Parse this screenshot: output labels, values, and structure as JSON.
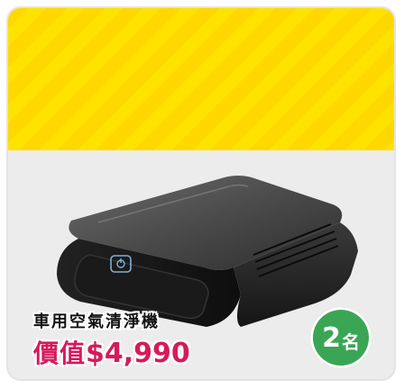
{
  "prize": {
    "product_name": "車用空氣清淨機",
    "price_label": "價值",
    "price_value": "$4,990",
    "quantity_number": "2",
    "quantity_unit": "名"
  },
  "colors": {
    "banner_yellow": "#ffd800",
    "price_pink": "#d61a5c",
    "badge_green": "#3aa655"
  },
  "icons": {
    "product": "car-air-purifier-image",
    "power": "power-button-icon"
  }
}
